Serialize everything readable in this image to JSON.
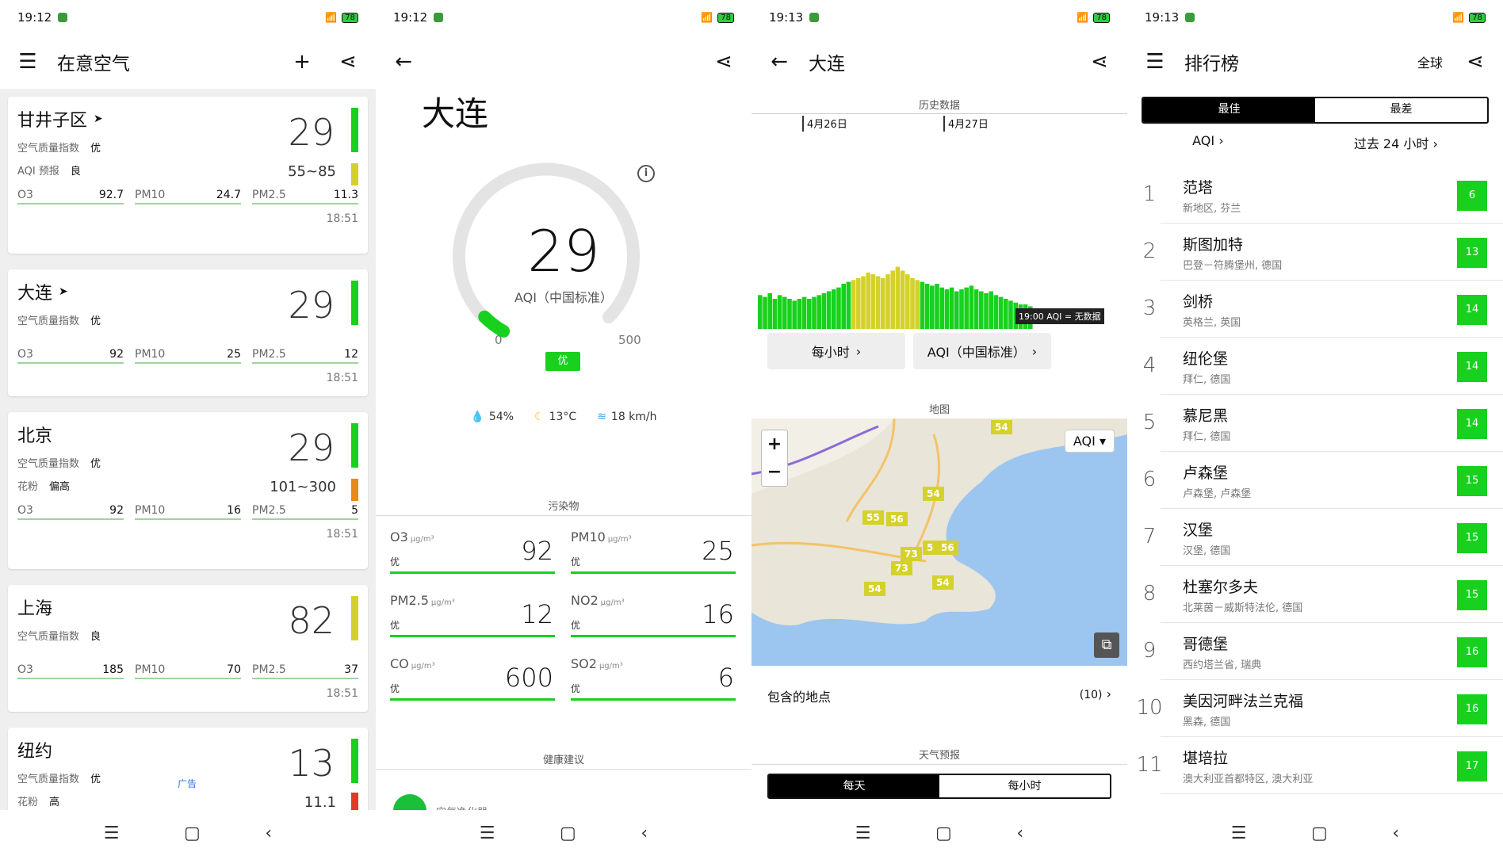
{
  "status": [
    {
      "time": "19:12",
      "battery": "78"
    },
    {
      "time": "19:12",
      "battery": "78"
    },
    {
      "time": "19:13",
      "battery": "78"
    },
    {
      "time": "19:13",
      "battery": "78"
    }
  ],
  "screen1": {
    "title": "在意空气",
    "cards": [
      {
        "city": "甘井子区",
        "aqi": "29",
        "aqi_label": "空气质量指数",
        "level": "优",
        "bar_color": "#18d11f",
        "extra_label": "AQI 预报",
        "extra_level": "良",
        "extra_range": "55~85",
        "extra_color": "#d4d22a",
        "pols": [
          {
            "n": "O3",
            "v": "92.7"
          },
          {
            "n": "PM10",
            "v": "24.7"
          },
          {
            "n": "PM2.5",
            "v": "11.3"
          }
        ],
        "time": "18:51"
      },
      {
        "city": "大连",
        "aqi": "29",
        "aqi_label": "空气质量指数",
        "level": "优",
        "bar_color": "#18d11f",
        "pols": [
          {
            "n": "O3",
            "v": "92"
          },
          {
            "n": "PM10",
            "v": "25"
          },
          {
            "n": "PM2.5",
            "v": "12"
          }
        ],
        "time": "18:51"
      },
      {
        "city": "北京",
        "aqi": "29",
        "aqi_label": "空气质量指数",
        "level": "优",
        "bar_color": "#18d11f",
        "extra_label": "花粉",
        "extra_level": "偏高",
        "extra_range": "101~300",
        "extra_color": "#e88a1a",
        "pols": [
          {
            "n": "O3",
            "v": "92"
          },
          {
            "n": "PM10",
            "v": "16"
          },
          {
            "n": "PM2.5",
            "v": "5"
          }
        ],
        "time": "18:51"
      },
      {
        "city": "上海",
        "aqi": "82",
        "aqi_label": "空气质量指数",
        "level": "良",
        "bar_color": "#d4d22a",
        "pols": [
          {
            "n": "O3",
            "v": "185"
          },
          {
            "n": "PM10",
            "v": "70"
          },
          {
            "n": "PM2.5",
            "v": "37"
          }
        ],
        "time": "18:51"
      },
      {
        "city": "纽约",
        "aqi": "13",
        "aqi_label": "空气质量指数",
        "level": "优",
        "bar_color": "#18d11f",
        "ad": "广告",
        "extra_label": "花粉",
        "extra_level": "高",
        "extra_range": "11.1",
        "extra_color": "#e23a2a"
      }
    ]
  },
  "screen2": {
    "city": "大连",
    "aqi": "29",
    "aqi_label": "AQI（中国标准）",
    "aqi_fraction": 0.058,
    "min": "0",
    "max": "500",
    "level": "优",
    "humidity": "54%",
    "temp": "13°C",
    "wind": "18 km/h",
    "pollutants_title": "污染物",
    "pollutants": [
      {
        "name": "O3",
        "unit": "μg/m³",
        "level": "优",
        "value": "92"
      },
      {
        "name": "PM10",
        "unit": "μg/m³",
        "level": "优",
        "value": "25"
      },
      {
        "name": "PM2.5",
        "unit": "μg/m³",
        "level": "优",
        "value": "12"
      },
      {
        "name": "NO2",
        "unit": "μg/m³",
        "level": "优",
        "value": "16"
      },
      {
        "name": "CO",
        "unit": "μg/m³",
        "level": "优",
        "value": "600"
      },
      {
        "name": "SO2",
        "unit": "μg/m³",
        "level": "优",
        "value": "6"
      }
    ],
    "health_title": "健康建议",
    "health_item": "空气净化器"
  },
  "screen3": {
    "title": "大连",
    "history_title": "历史数据",
    "dates": [
      "4月26日",
      "4月27日"
    ],
    "tooltip": "19:00 AQI = 无数据",
    "hourly_btn": "每小时",
    "standard_btn": "AQI（中国标准）",
    "map_title": "地图",
    "map_select": "AQI",
    "markers": [
      "54",
      "54",
      "55",
      "56",
      "5",
      "56",
      "73",
      "73",
      "54",
      "54"
    ],
    "places_label": "包含的地点",
    "places_count": "(10)",
    "forecast_title": "天气预报",
    "forecast_tabs": [
      "每天",
      "每小时"
    ]
  },
  "chart_data": {
    "type": "bar",
    "title": "历史数据",
    "categories": [
      "4月26日",
      "4月27日"
    ],
    "series": [
      {
        "values": [
          18,
          17,
          19,
          16,
          18,
          17,
          16,
          15,
          16,
          17,
          16,
          17,
          18,
          19,
          20,
          21,
          22,
          24,
          25,
          26,
          27,
          28,
          30,
          29,
          28,
          27,
          29,
          31,
          33,
          31,
          29,
          27,
          26,
          25,
          24,
          23,
          24,
          22,
          21,
          22,
          20,
          21,
          22,
          23,
          21,
          20,
          19,
          20,
          18,
          17,
          16,
          15,
          14,
          13,
          13,
          12
        ]
      }
    ]
  },
  "screen4": {
    "title": "排行榜",
    "scope": "全球",
    "tabs": [
      "最佳",
      "最差"
    ],
    "filter_metric": "AQI",
    "filter_period": "过去 24 小时",
    "rows": [
      {
        "rank": "1",
        "name": "范塔",
        "sub": "新地区, 芬兰",
        "aqi": "6"
      },
      {
        "rank": "2",
        "name": "斯图加特",
        "sub": "巴登－符腾堡州, 德国",
        "aqi": "13"
      },
      {
        "rank": "3",
        "name": "剑桥",
        "sub": "英格兰, 英国",
        "aqi": "14"
      },
      {
        "rank": "4",
        "name": "纽伦堡",
        "sub": "拜仁, 德国",
        "aqi": "14"
      },
      {
        "rank": "5",
        "name": "慕尼黑",
        "sub": "拜仁, 德国",
        "aqi": "14"
      },
      {
        "rank": "6",
        "name": "卢森堡",
        "sub": "卢森堡, 卢森堡",
        "aqi": "15"
      },
      {
        "rank": "7",
        "name": "汉堡",
        "sub": "汉堡, 德国",
        "aqi": "15"
      },
      {
        "rank": "8",
        "name": "杜塞尔多夫",
        "sub": "北莱茵－威斯特法伦, 德国",
        "aqi": "15"
      },
      {
        "rank": "9",
        "name": "哥德堡",
        "sub": "西约塔兰省, 瑞典",
        "aqi": "16"
      },
      {
        "rank": "10",
        "name": "美因河畔法兰克福",
        "sub": "黑森, 德国",
        "aqi": "16"
      },
      {
        "rank": "11",
        "name": "堪培拉",
        "sub": "澳大利亚首都特区, 澳大利亚",
        "aqi": "17"
      }
    ]
  },
  "icons": {
    "menu": "menu-icon",
    "add": "plus-icon",
    "share": "share-icon",
    "back": "back-arrow-icon",
    "info": "info-icon",
    "nav_menu": "nav-menu-icon",
    "nav_home": "nav-home-icon",
    "nav_back": "nav-back-icon"
  }
}
